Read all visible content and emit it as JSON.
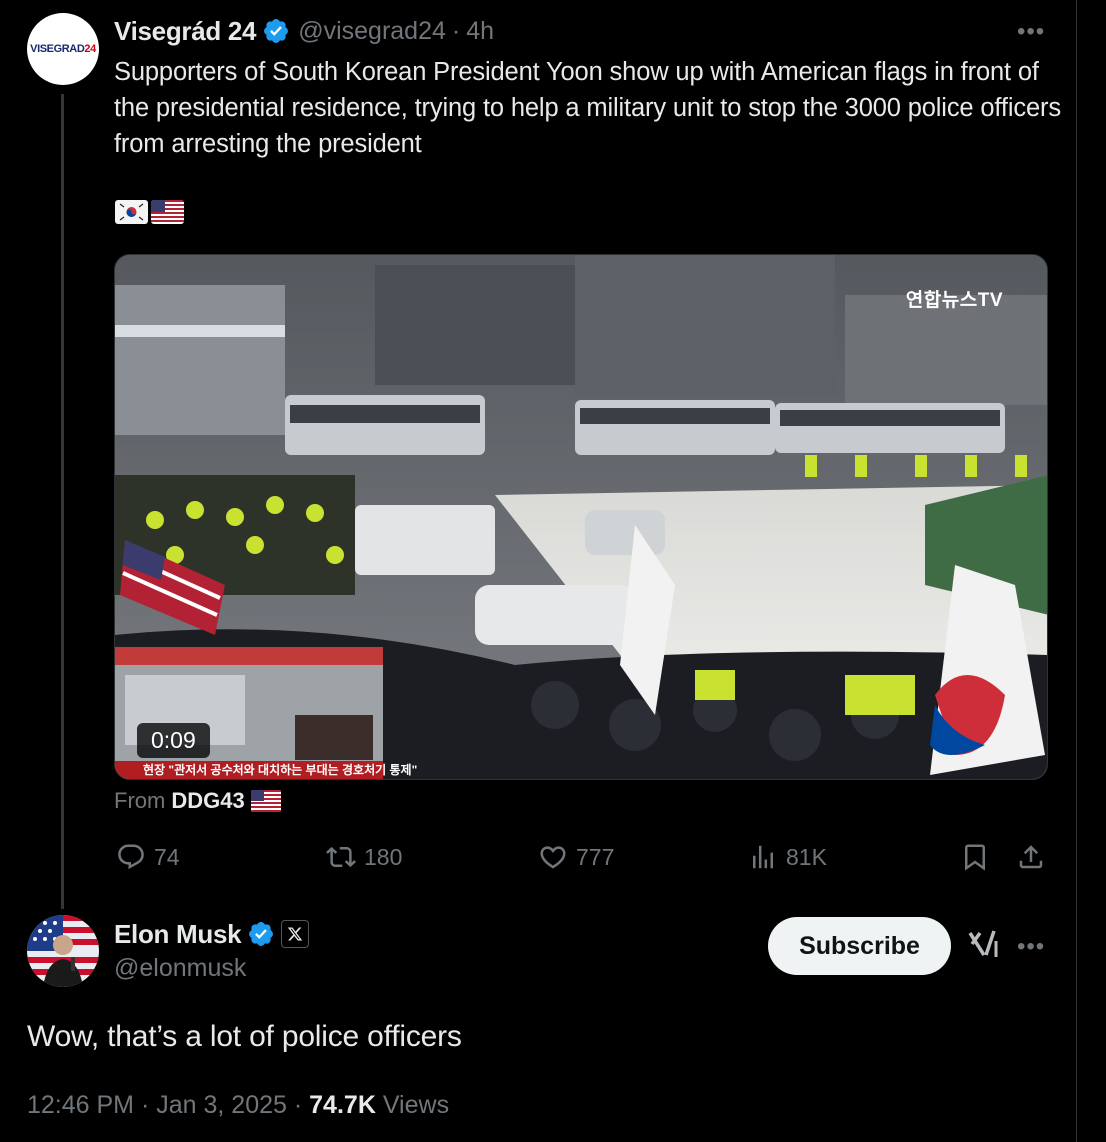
{
  "original_tweet": {
    "author_name": "Visegrád 24",
    "handle": "@visegrad24",
    "separator": "·",
    "time_ago": "4h",
    "avatar_text": "VISEGRAD",
    "avatar_text_accent": "24",
    "text": "Supporters of South Korean President Yoon show up with American flags in front of the presidential residence, trying to help a military unit to stop the 3000 police officers from arresting the president",
    "emoji_flags": [
      "flag-south-korea-icon",
      "flag-usa-icon"
    ],
    "media": {
      "duration": "0:09",
      "watermark": "연합뉴스TV",
      "inset_caption": "현장 \"관저서 공수처와 대치하는 부대는 경호처기 통제\""
    },
    "source_label": "From",
    "source_name": "DDG43",
    "actions": {
      "replies": "74",
      "reposts": "180",
      "likes": "777",
      "views": "81K"
    }
  },
  "reply_tweet": {
    "author_name": "Elon Musk",
    "handle": "@elonmusk",
    "subscribe_label": "Subscribe",
    "text": "Wow, that’s a lot of police officers",
    "time": "12:46 PM",
    "date": "Jan 3, 2025",
    "separator": "·",
    "views_count": "74.7K",
    "views_label": "Views"
  },
  "colors": {
    "background": "#000000",
    "text_primary": "#e7e9ea",
    "text_secondary": "#71767b",
    "verified_blue": "#1d9bf0",
    "divider": "#2f3336"
  }
}
